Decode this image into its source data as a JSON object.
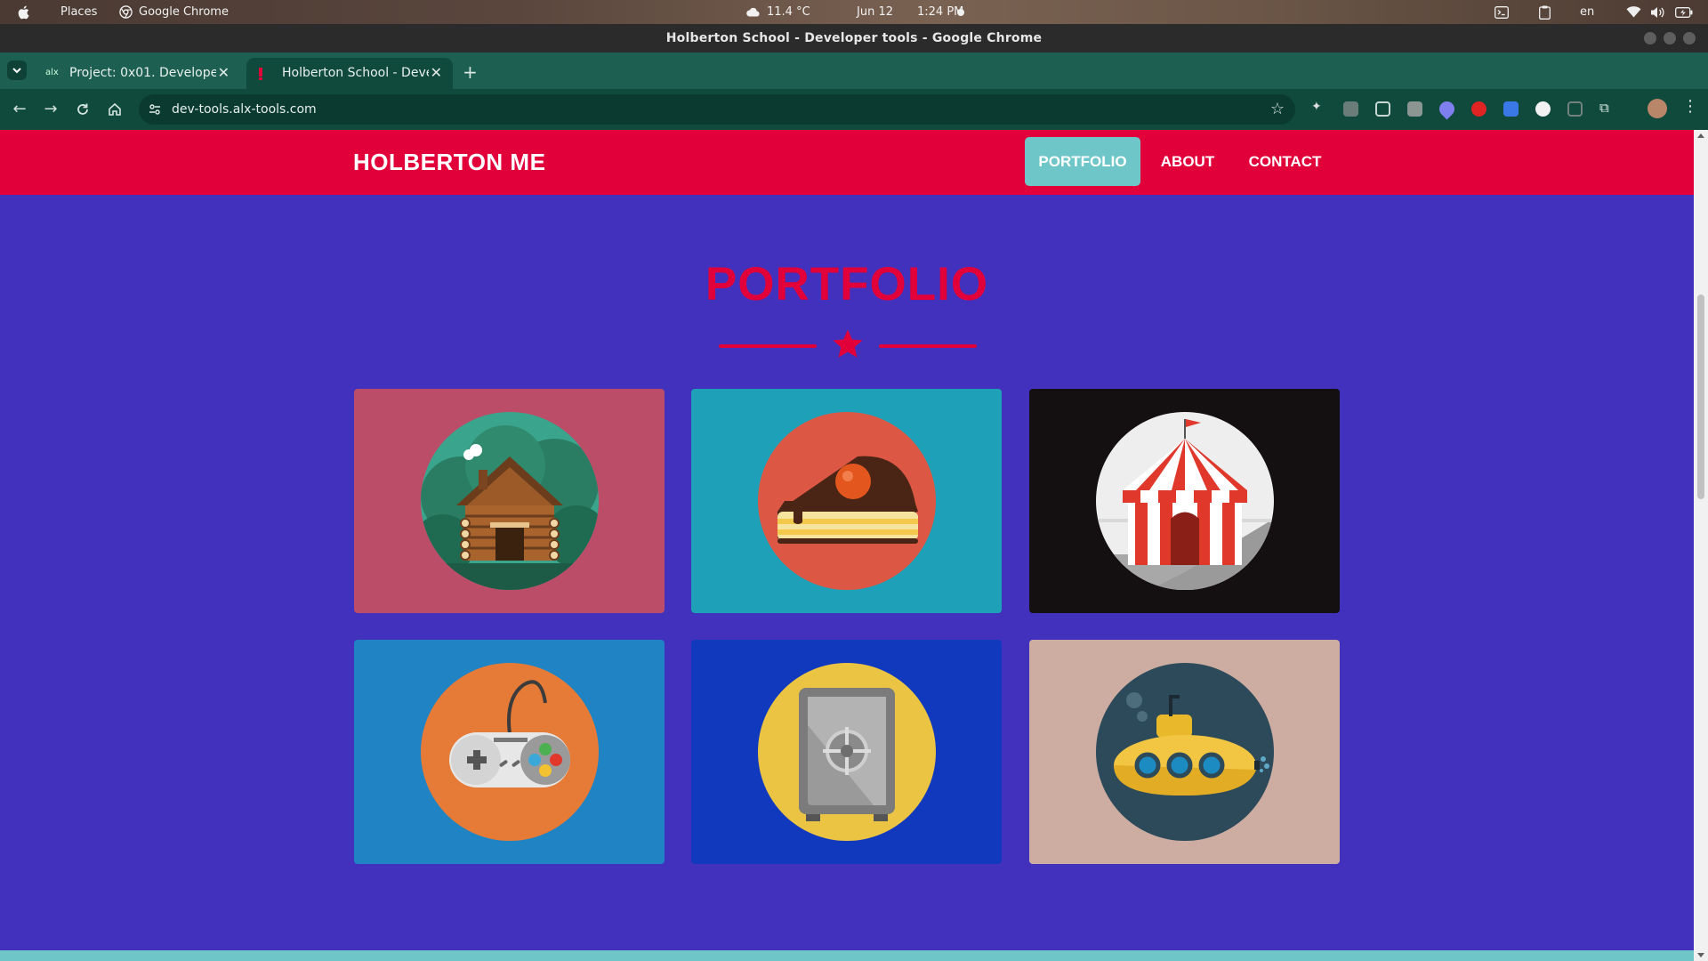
{
  "os_bar": {
    "places": "Places",
    "app": "Google Chrome",
    "temperature": "11.4 °C",
    "date": "Jun 12",
    "time": "1:24 PM",
    "language": "en"
  },
  "window": {
    "title": "Holberton School - Developer tools - Google Chrome"
  },
  "tabs": [
    {
      "label": "Project: 0x01. Developer",
      "favicon": "alx"
    },
    {
      "label": "Holberton School - Deve"
    }
  ],
  "toolbar": {
    "url": "dev-tools.alx-tools.com"
  },
  "site": {
    "brand": "HOLBERTON ME",
    "nav": [
      {
        "label": "PORTFOLIO",
        "active": true
      },
      {
        "label": "ABOUT"
      },
      {
        "label": "CONTACT"
      }
    ],
    "heading": "PORTFOLIO",
    "portfolio_items": [
      {
        "icon": "cabin-icon",
        "background": "#bb4d68"
      },
      {
        "icon": "cake-icon",
        "background": "#1ea1b8"
      },
      {
        "icon": "circus-tent-icon",
        "background": "#140f10"
      },
      {
        "icon": "game-controller-icon",
        "background": "#1f83c4"
      },
      {
        "icon": "safe-icon",
        "background": "#1039bd"
      },
      {
        "icon": "submarine-icon",
        "background": "#cdada2"
      }
    ]
  },
  "colors": {
    "primary_red": "#e2003a",
    "page_background": "#4231bc",
    "accent_teal": "#6ec6c8"
  }
}
